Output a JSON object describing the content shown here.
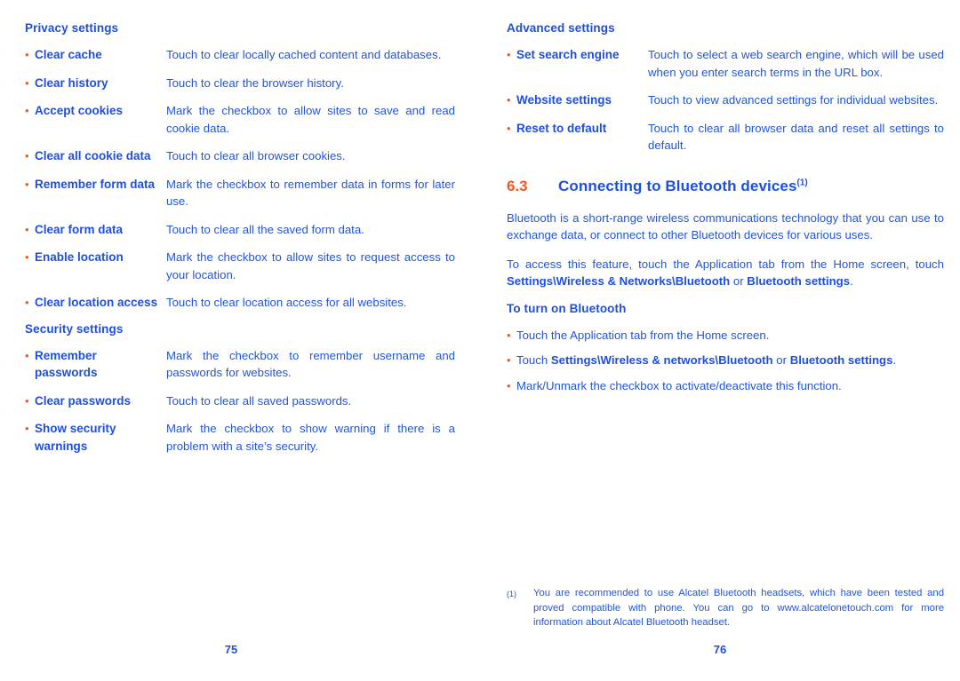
{
  "colors": {
    "text_blue": "#2255dd",
    "heading_blue": "#1f4fe0",
    "accent_orange": "#f05a22"
  },
  "bullet_glyph": "•",
  "left_page": {
    "page_number": "75",
    "sections": [
      {
        "heading": "Privacy settings",
        "items": [
          {
            "term": "Clear cache",
            "desc": "Touch to clear locally cached content and databases."
          },
          {
            "term": "Clear history",
            "desc": "Touch to clear the browser history."
          },
          {
            "term": "Accept cookies",
            "desc": "Mark the checkbox to allow sites to save and read cookie data."
          },
          {
            "term": "Clear all cookie data",
            "desc": "Touch to clear all browser cookies."
          },
          {
            "term": "Remember form data",
            "desc": "Mark the checkbox to remember data in forms for later use."
          },
          {
            "term": "Clear form data",
            "desc": "Touch to clear all the saved form data."
          },
          {
            "term": "Enable location",
            "desc": "Mark the checkbox to allow sites to request access to your location."
          },
          {
            "term": "Clear location access",
            "desc": "Touch to clear location access for all websites."
          }
        ]
      },
      {
        "heading": "Security settings",
        "items": [
          {
            "term": "Remember passwords",
            "desc": "Mark the checkbox to remember username and passwords for websites."
          },
          {
            "term": "Clear passwords",
            "desc": "Touch to clear all saved passwords."
          },
          {
            "term": "Show security warnings",
            "desc": "Mark the checkbox to show warning if there is a problem with a site’s security."
          }
        ]
      }
    ]
  },
  "right_page": {
    "page_number": "76",
    "advanced": {
      "heading": "Advanced settings",
      "items": [
        {
          "term": "Set search engine",
          "desc": "Touch to select a web search engine, which will be used when you enter search terms in the URL box."
        },
        {
          "term": "Website settings",
          "desc": "Touch to view advanced settings for individual websites."
        },
        {
          "term": "Reset to default",
          "desc": "Touch to clear all browser data and reset all settings to default."
        }
      ]
    },
    "section": {
      "number": "6.3",
      "title": "Connecting to Bluetooth devices",
      "superscript": "(1)"
    },
    "paragraph_1": "Bluetooth is a short-range wireless communications technology that you can use to exchange data, or connect to other Bluetooth devices for various uses.",
    "paragraph_2": {
      "part_1": "To access this feature, touch the Application tab from the Home screen, touch ",
      "bold_1": "Settings\\Wireless & Networks\\Bluetooth",
      "part_2": " or ",
      "bold_2": "Bluetooth settings",
      "part_3": "."
    },
    "turn_on": {
      "heading": "To turn on Bluetooth",
      "step_1": "Touch the Application tab from the Home screen.",
      "step_2": {
        "part_1": "Touch ",
        "bold_1": "Settings\\Wireless & networks\\Bluetooth",
        "part_2": " or ",
        "bold_2": "Bluetooth settings",
        "part_3": "."
      },
      "step_3": "Mark/Unmark the checkbox to activate/deactivate this function."
    },
    "footnote": {
      "marker": "(1)",
      "text": "You are recommended to use Alcatel Bluetooth headsets, which have been tested and proved compatible with phone. You can go to www.alcatelonetouch.com for more information about Alcatel Bluetooth headset."
    }
  }
}
